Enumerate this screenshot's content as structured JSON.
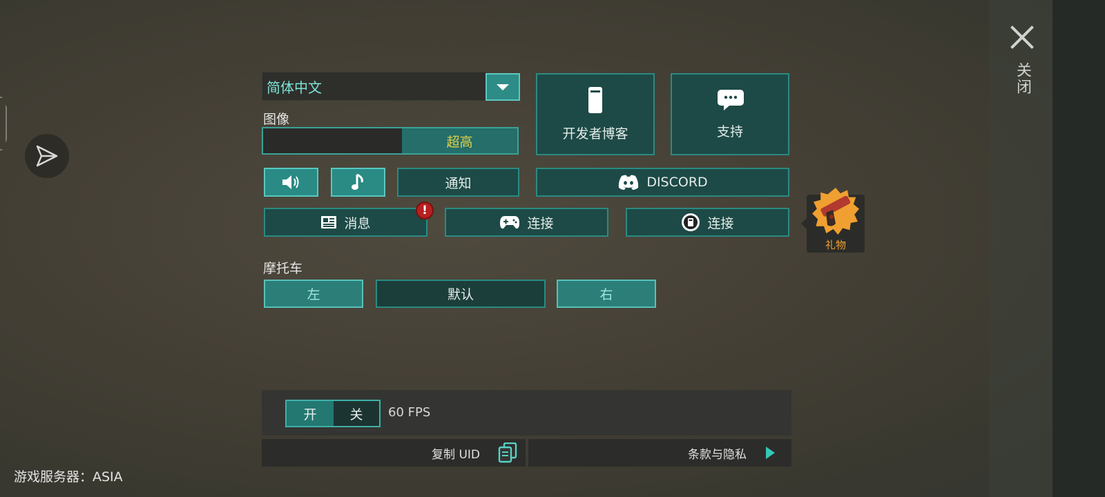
{
  "close": {
    "label": "关闭"
  },
  "language": {
    "selected": "简体中文"
  },
  "graphics": {
    "label": "图像",
    "quality": "超高",
    "quality_level": 1.0
  },
  "links": {
    "dev_blog": "开发者博客",
    "support": "支持",
    "discord": "DISCORD"
  },
  "audio": {
    "notify": "通知"
  },
  "social": {
    "news": "消息",
    "connect_gamepad": "连接",
    "connect_other": "连接"
  },
  "gift": {
    "label": "礼物"
  },
  "motorcycle": {
    "label": "摩托车",
    "left": "左",
    "default": "默认",
    "right": "右"
  },
  "fps_toggle": {
    "on": "开",
    "off": "关",
    "value": "60 FPS"
  },
  "footer": {
    "copy_uid": "复制 UID",
    "terms": "条款与隐私"
  },
  "server": {
    "label": "游戏服务器：ASIA"
  },
  "colors": {
    "accent": "#2b8a83",
    "gold": "#e2d14a",
    "gift": "#f0a030",
    "alert": "#b62020"
  }
}
